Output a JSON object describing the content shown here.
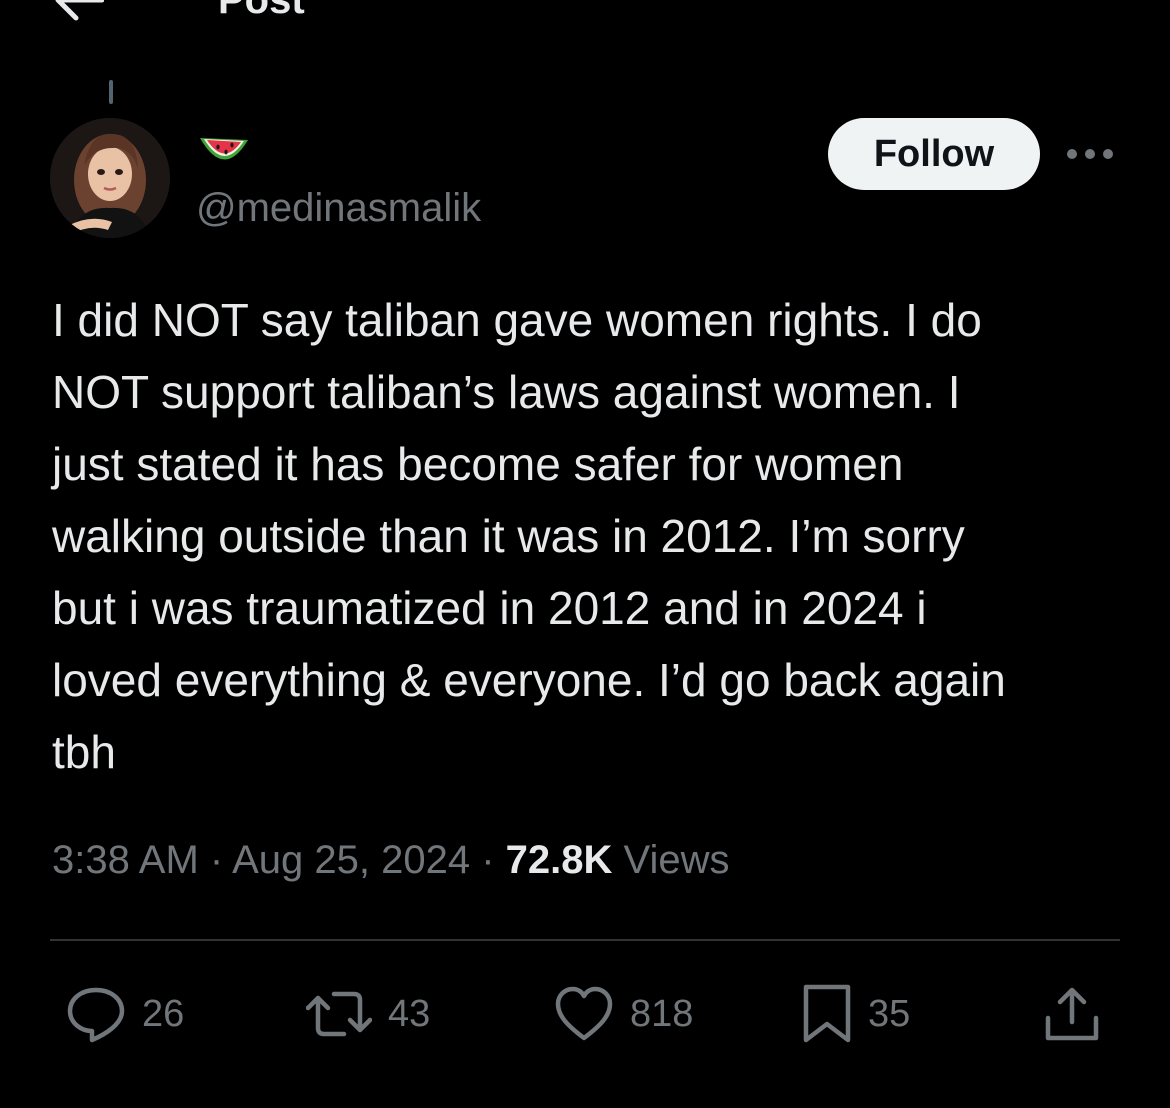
{
  "header": {
    "title": "Post",
    "back_icon": "arrow-left-icon"
  },
  "post": {
    "author": {
      "display_name_emoji": "watermelon-icon",
      "handle": "@medinasmalik",
      "avatar": "avatar-image"
    },
    "follow_label": "Follow",
    "more_icon": "more-horizontal-icon",
    "text": "I did NOT say taliban gave women rights. I do\nNOT support taliban’s laws against women. I\njust stated it has become safer for women\nwalking outside than it was in 2012. I’m sorry\nbut i was traumatized in 2012 and in 2024 i\nloved everything & everyone. I’d go back again\ntbh",
    "time": "3:38 AM",
    "separator": " · ",
    "date": "Aug 25, 2024",
    "views_count": "72.8K",
    "views_label": " Views"
  },
  "actions": {
    "reply": {
      "icon": "reply-icon",
      "count": "26"
    },
    "repost": {
      "icon": "repost-icon",
      "count": "43"
    },
    "like": {
      "icon": "heart-icon",
      "count": "818"
    },
    "bookmark": {
      "icon": "bookmark-icon",
      "count": "35"
    },
    "share": {
      "icon": "share-icon"
    }
  },
  "colors": {
    "background": "#000000",
    "text_primary": "#e7e9ea",
    "text_secondary": "#71767b",
    "divider": "#2f3336",
    "follow_bg": "#eff3f4"
  }
}
